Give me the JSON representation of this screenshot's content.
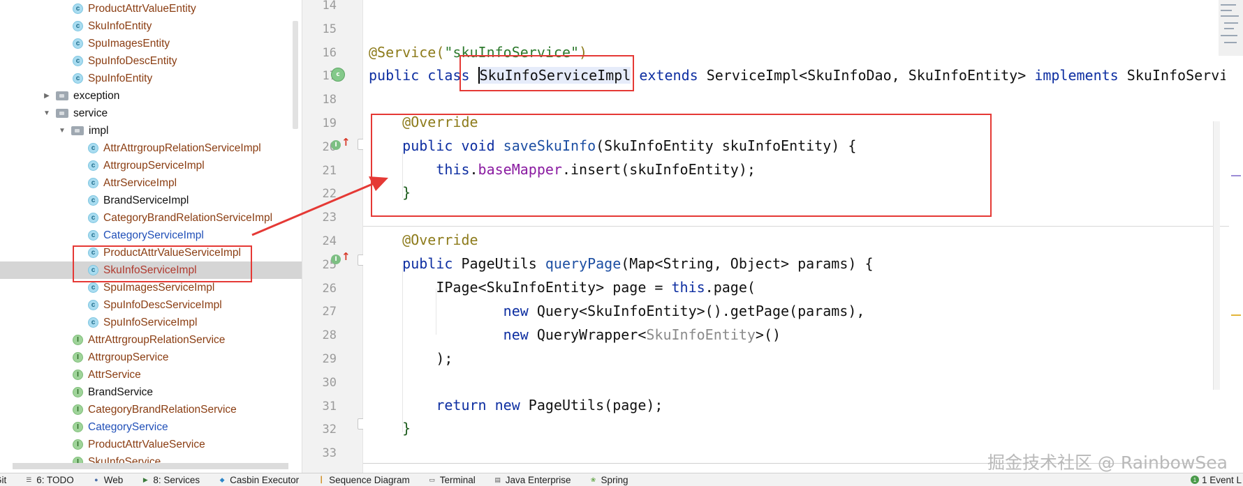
{
  "project_tree": {
    "items": [
      {
        "label": "ProductAttrValueEntity",
        "kind": "class",
        "color": "brown"
      },
      {
        "label": "SkuInfoEntity",
        "kind": "class",
        "color": "brown"
      },
      {
        "label": "SpuImagesEntity",
        "kind": "class",
        "color": "brown"
      },
      {
        "label": "SpuInfoDescEntity",
        "kind": "class",
        "color": "brown"
      },
      {
        "label": "SpuInfoEntity",
        "kind": "class",
        "color": "brown"
      },
      {
        "label": "exception",
        "kind": "folder",
        "expanded": false
      },
      {
        "label": "service",
        "kind": "folder",
        "expanded": true
      },
      {
        "label": "impl",
        "kind": "folder",
        "expanded": true
      },
      {
        "label": "AttrAttrgroupRelationServiceImpl",
        "kind": "class",
        "color": "brown"
      },
      {
        "label": "AttrgroupServiceImpl",
        "kind": "class",
        "color": "brown"
      },
      {
        "label": "AttrServiceImpl",
        "kind": "class",
        "color": "brown"
      },
      {
        "label": "BrandServiceImpl",
        "kind": "class",
        "color": "black"
      },
      {
        "label": "CategoryBrandRelationServiceImpl",
        "kind": "class",
        "color": "brown"
      },
      {
        "label": "CategoryServiceImpl",
        "kind": "class",
        "color": "blue"
      },
      {
        "label": "ProductAttrValueServiceImpl",
        "kind": "class",
        "color": "brown"
      },
      {
        "label": "SkuInfoServiceImpl",
        "kind": "class",
        "color": "red",
        "selected": true
      },
      {
        "label": "SpuImagesServiceImpl",
        "kind": "class",
        "color": "brown"
      },
      {
        "label": "SpuInfoDescServiceImpl",
        "kind": "class",
        "color": "brown"
      },
      {
        "label": "SpuInfoServiceImpl",
        "kind": "class",
        "color": "brown"
      },
      {
        "label": "AttrAttrgroupRelationService",
        "kind": "interface",
        "color": "brown"
      },
      {
        "label": "AttrgroupService",
        "kind": "interface",
        "color": "brown"
      },
      {
        "label": "AttrService",
        "kind": "interface",
        "color": "brown"
      },
      {
        "label": "BrandService",
        "kind": "interface",
        "color": "black"
      },
      {
        "label": "CategoryBrandRelationService",
        "kind": "interface",
        "color": "brown"
      },
      {
        "label": "CategoryService",
        "kind": "interface",
        "color": "blue"
      },
      {
        "label": "ProductAttrValueService",
        "kind": "interface",
        "color": "brown"
      },
      {
        "label": "SkuInfoService",
        "kind": "interface",
        "color": "brown"
      }
    ]
  },
  "editor": {
    "line_numbers": [
      "14",
      "15",
      "16",
      "17",
      "18",
      "19",
      "20",
      "21",
      "22",
      "23",
      "24",
      "25",
      "26",
      "27",
      "28",
      "29",
      "30",
      "31",
      "32",
      "33"
    ],
    "code": {
      "l16_annotation": "@Service(",
      "l16_string": "\"skuInfoService\"",
      "l16_close": ")",
      "l17_public": "public",
      "l17_class": "class",
      "l17_name": "SkuInfoServiceImpl",
      "l17_extends": "extends",
      "l17_type": "ServiceImpl<SkuInfoDao, SkuInfoEntity>",
      "l17_implements": "implements",
      "l17_iface": "SkuInfoServi",
      "l19_override": "@Override",
      "l20_public_void": "public void",
      "l20_method": "saveSkuInfo",
      "l20_params": "(SkuInfoEntity skuInfoEntity) {",
      "l21_this": "this",
      "l21_dot": ".",
      "l21_field": "baseMapper",
      "l21_call": ".insert(skuInfoEntity);",
      "l22_close": "}",
      "l24_override": "@Override",
      "l25_public": "public",
      "l25_type": "PageUtils",
      "l25_method": "queryPage",
      "l25_params": "(Map<String, Object> params) {",
      "l26_type": "IPage<SkuInfoEntity> page = ",
      "l26_this": "this",
      "l26_rest": ".page(",
      "l27_new": "new",
      "l27_rest": "Query<SkuInfoEntity>().getPage(params),",
      "l28_new": "new",
      "l28_type": "QueryWrapper<",
      "l28_generic": "SkuInfoEntity",
      "l28_rest": ">()",
      "l29_close": ");",
      "l31_return": "return new",
      "l31_rest": "PageUtils(page);",
      "l32_close": "}"
    }
  },
  "toolbar": {
    "items": [
      {
        "label": "Git",
        "icon": "git-icon"
      },
      {
        "label": "6: TODO",
        "icon": "todo-icon"
      },
      {
        "label": "Web",
        "icon": "web-icon"
      },
      {
        "label": "8: Services",
        "icon": "services-icon"
      },
      {
        "label": "Casbin Executor",
        "icon": "casbin-icon"
      },
      {
        "label": "Sequence Diagram",
        "icon": "sequence-icon"
      },
      {
        "label": "Terminal",
        "icon": "terminal-icon"
      },
      {
        "label": "Java Enterprise",
        "icon": "java-enterprise-icon"
      },
      {
        "label": "Spring",
        "icon": "spring-icon"
      }
    ],
    "event_log": "1 Event L"
  },
  "watermark": "掘金技术社区 @ RainbowSea",
  "colors": {
    "annotation_red": "#e53935",
    "keyword": "#0d2ea1",
    "annotation": "#8d7b1b",
    "string": "#2d7a2d",
    "field": "#8a1ba1"
  }
}
